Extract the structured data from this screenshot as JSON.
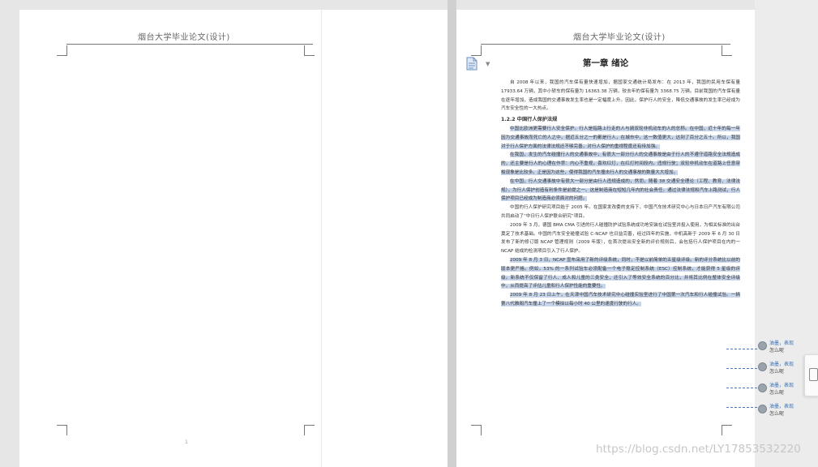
{
  "left_page": {
    "header_title": "烟台大学毕业论文(设计)",
    "page_number": "1"
  },
  "right_page": {
    "header_title": "烟台大学毕业论文(设计)",
    "chapter_title": "第一章  绪论",
    "paragraphs": [
      {
        "text": "自 2008 年以来，我国的汽车保有量快速增加，据国家交通统计局发布：在 2013 年，我国的民用车保有量 17933.64 万辆，其中小轿车的保有量为 16363.38 万辆，较去年的保有量为 3368.75 万辆。目前我国的汽车保有量在逐年增加，造成我国的交通事故发生率也是一定幅度上升。因此，保护行人的安全，降低交通事故的发生率已经成为汽车安全性的一大热点。",
        "highlight": false
      },
      {
        "text": "1.2.2 中国行人保护法规",
        "highlight": false,
        "heading": true
      },
      {
        "text": "中国比欧洲更需要行人安全保护。行人是指路上行走的人与骑双轮非机动车的人的总称。在中国，近十年的每一年因为交通事故而死亡的人之中，据近五分之一的都是行人，在城市中，这一数值更大，达到了百分之五十。所以，我国对于行人保护方面的法律法规还不够完善，对行人保护的重视程度还有待加强。",
        "highlight": true
      },
      {
        "text": "在我国，发生的汽车碰撞行人的交通事故中，有很大一部分行人的交通事故是由于行人的不遵守道路安全法规造成的，还主要是行人的心理在作祟：内心不重视，喜欢红灯，在红灯时间段内，违规行驶；双轮非机动车在道路上任意穿梭现象是比较多。正是因为这些，使得我国的汽车撞击行人的交通事故的数量大大增加。",
        "highlight": true
      },
      {
        "text": "在中国，行人交通事故中有很大一部分是由行人违规造成的，然而，随着 38 交通安全理论（工程、教育、法律法规），为行人保护创造有利条件是前提之一。这是制造商在短短几年内的社会责任。通过法律法规和汽车上路测试，行人保护项目已经成为制造商必须面对的问题。",
        "highlight": true
      },
      {
        "text": "中国的行人保护研究项目始于 2005 年。在国家发改委的支持下，中国汽车技术研究中心与日本日产汽车有限公司共同启动了“中日行人保护联合研究”项目。",
        "highlight": false
      },
      {
        "text": "2009 年 3 月，德国 BMA CMA 引进的行人碰撞防护试验系统成功地安装在试验室并投入使用，为相关标准的出台奠定了技术基础。中国的汽车安全碰撞试验 C-NCAP 也日益完善，经过四年的实施，中机高新于 2009 年 6 月 30 日发布了新的修订版 NCAP 管理规则（2009 年版），在首次提出安全新的评价规则后，会包括行人保护项目在内的一NCAP 结成的检测项目引入了行人保护。",
        "highlight": false
      },
      {
        "text": "2009 年 8 月 3 日，NCAP 宣布采用了新的评级系统，同时，不是以前简单的五星级评级。新的评分系统比以前的版本更严格。例如，53% 的一系列试验车必须配备一个电子稳定控制系统（ESC）控制系统，才能获得 5 星级的评级。新系统不仅保留了行人、成人和儿童的三类安全，还引入了等效安全系统的百分比，并将其比例在整体安全评级中，从而提高了评估儿童和行人保护性能的重要性。",
        "highlight": true
      },
      {
        "text": "2009 年 8 月 23 日上午，在天津中国汽车技术研究中心碰撞实验室进行了中国第一次汽车和行人碰撞试验。一辆第八代雅阁汽车撞上了一个模拟以每小时 40 公里的速度行驶的行人。",
        "highlight": true
      }
    ]
  },
  "comments": [
    {
      "author": "油墨，表现",
      "text": "怎么呢"
    },
    {
      "author": "油墨，表现",
      "text": "怎么呢"
    },
    {
      "author": "油墨，表现",
      "text": "怎么呢"
    },
    {
      "author": "油墨，表现",
      "text": "怎么呢"
    }
  ],
  "colors": {
    "selection": "#c8d6ec",
    "comment_link": "#4a7bc0"
  },
  "icons": {
    "page_icon": "document-icon",
    "dropdown": "chevron-down-icon",
    "panel": "panel-toggle-icon"
  },
  "watermark": "https://blog.csdn.net/LY17853532220"
}
